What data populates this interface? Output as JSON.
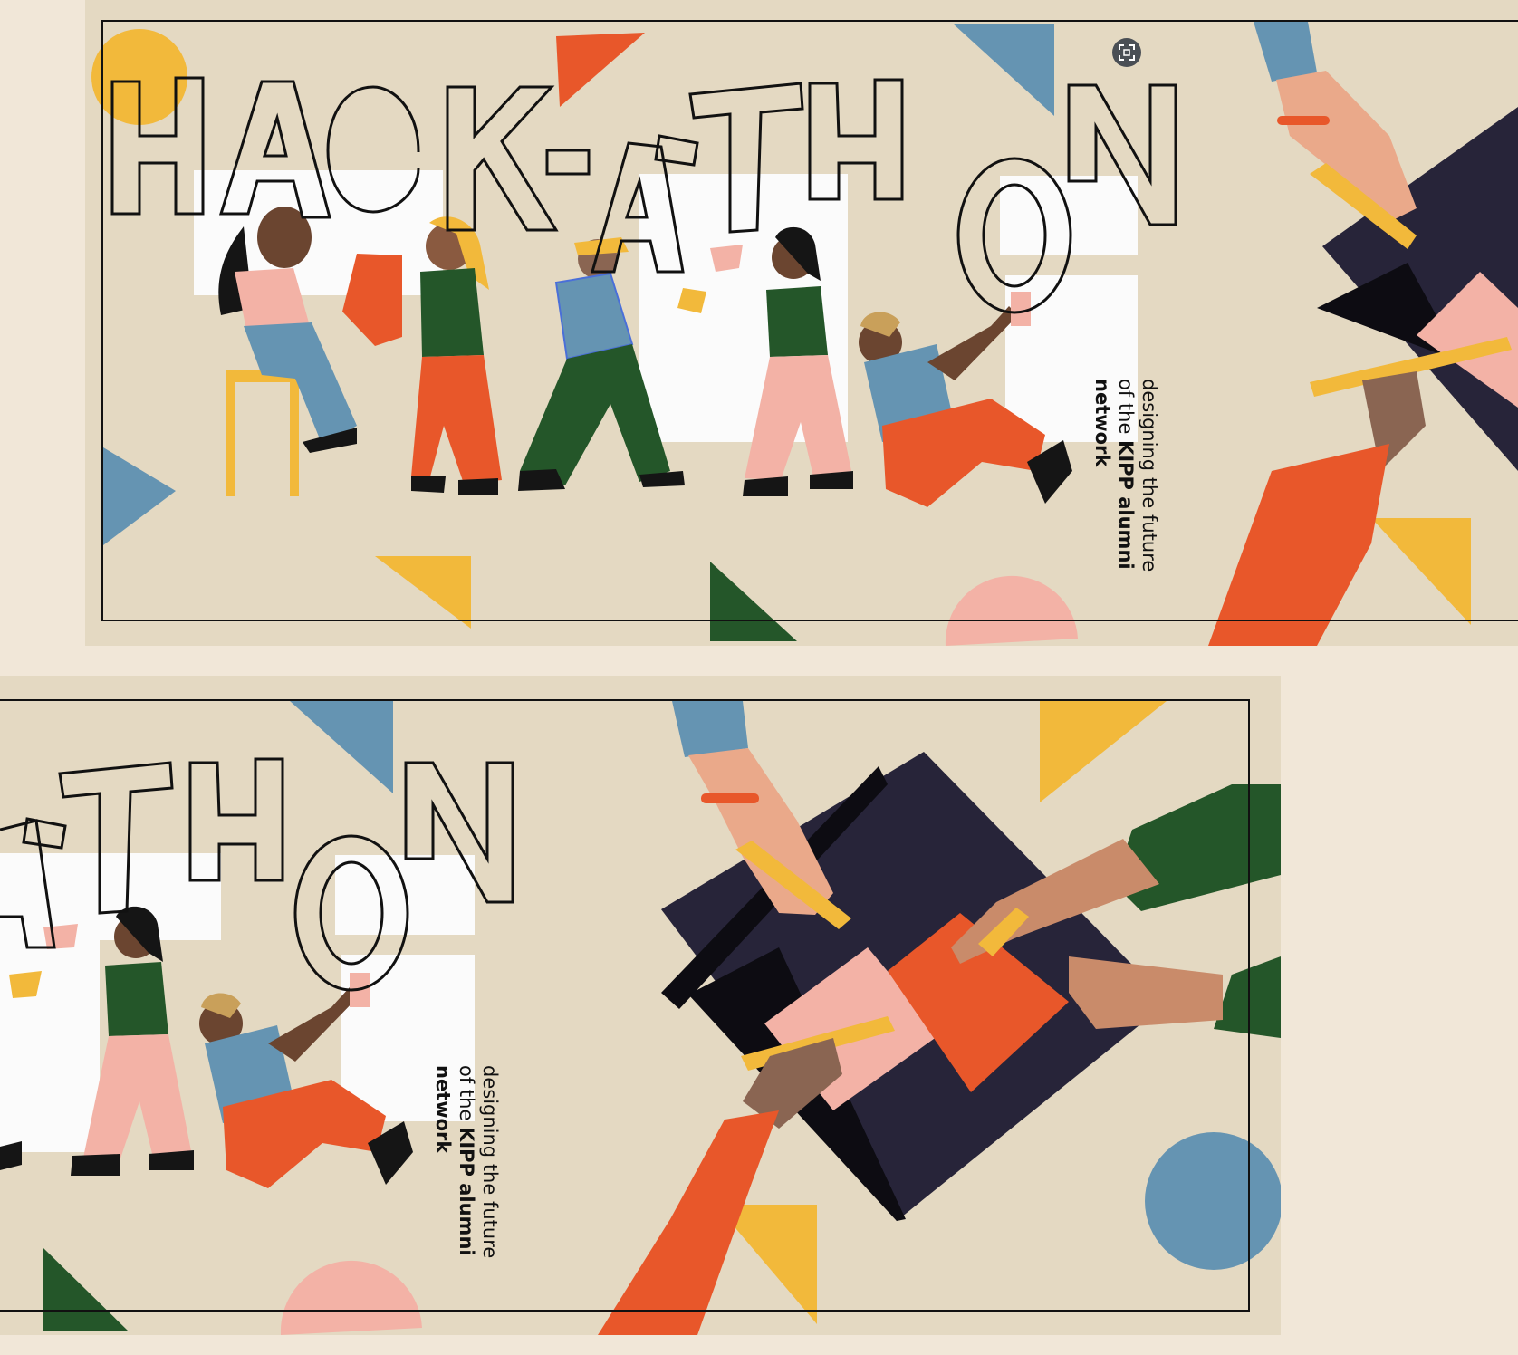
{
  "poster": {
    "title": "HACK-A-THON",
    "tagline_line1": "designing the future",
    "tagline_line2_prefix": "of the ",
    "tagline_line2_bold": "KIPP alumni",
    "tagline_line3_bold": "network"
  },
  "icons": {
    "expand": "expand-fullscreen-icon"
  },
  "colors": {
    "page_background": "#f1e7d8",
    "poster_background": "#e4d9c2",
    "blue": "#6594b2",
    "orange": "#e8572a",
    "yellow": "#f2b93b",
    "green": "#245629",
    "pink": "#f3b2a6",
    "navy": "#272439"
  }
}
